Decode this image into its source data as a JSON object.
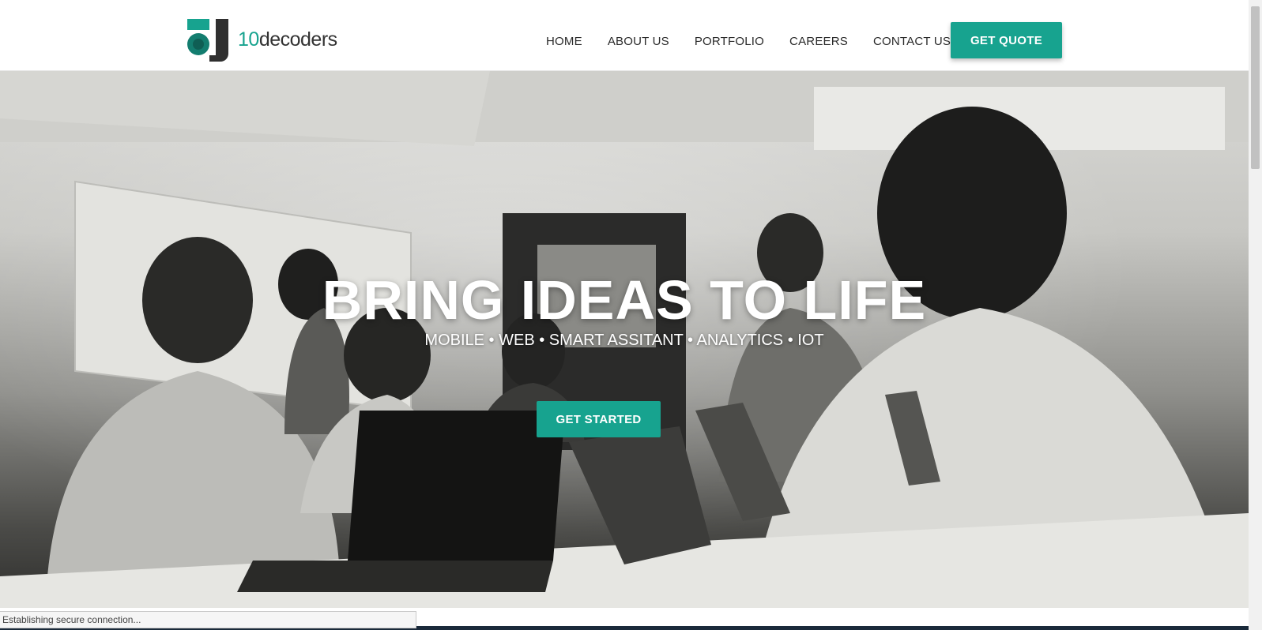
{
  "brand": {
    "logo_number": "10",
    "logo_word": "decoders",
    "accent_color": "#17a38f"
  },
  "nav": {
    "items": [
      {
        "label": "HOME"
      },
      {
        "label": "ABOUT US"
      },
      {
        "label": "PORTFOLIO"
      },
      {
        "label": "CAREERS"
      },
      {
        "label": "CONTACT US"
      }
    ],
    "cta_label": "GET QUOTE"
  },
  "hero": {
    "title": "BRING IDEAS TO LIFE",
    "subtitle": "MOBILE • WEB • SMART ASSITANT • ANALYTICS • IOT",
    "button_label": "GET STARTED"
  },
  "status": {
    "text": "Establishing secure connection..."
  }
}
